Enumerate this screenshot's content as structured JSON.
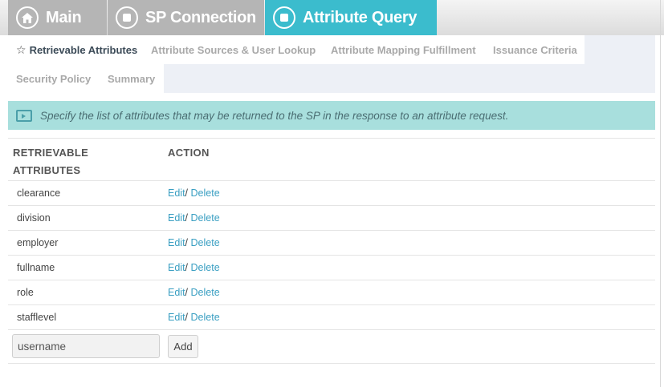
{
  "wizard": {
    "main_label": "Main",
    "sp_label": "SP Connection",
    "aq_label": "Attribute Query"
  },
  "tabs": [
    {
      "label": "Retrievable Attributes",
      "active": true
    },
    {
      "label": "Attribute Sources & User Lookup",
      "active": false
    },
    {
      "label": "Attribute Mapping Fulfillment",
      "active": false
    },
    {
      "label": "Issuance Criteria",
      "active": false
    },
    {
      "label": "Security Policy",
      "active": false
    },
    {
      "label": "Summary",
      "active": false
    }
  ],
  "banner": {
    "text": "Specify the list of attributes that may be returned to the SP in the response to an attribute request."
  },
  "table": {
    "headers": {
      "attributes_line1": "RETRIEVABLE",
      "attributes_line2": "ATTRIBUTES",
      "action": "ACTION"
    },
    "rows": [
      {
        "name": "clearance",
        "edit": "Edit",
        "sep": "/",
        "delete": "Delete"
      },
      {
        "name": "division",
        "edit": "Edit",
        "sep": "/",
        "delete": "Delete"
      },
      {
        "name": "employer",
        "edit": "Edit",
        "sep": "/",
        "delete": "Delete"
      },
      {
        "name": "fullname",
        "edit": "Edit",
        "sep": "/",
        "delete": "Delete"
      },
      {
        "name": "role",
        "edit": "Edit",
        "sep": "/",
        "delete": "Delete"
      },
      {
        "name": "stafflevel",
        "edit": "Edit",
        "sep": "/",
        "delete": "Delete"
      }
    ],
    "add": {
      "input_value": "username",
      "button_label": "Add"
    }
  },
  "colors": {
    "accent": "#3bbccd",
    "inactive_step": "#b5b5b5",
    "banner_bg": "#a8dfdd",
    "link": "#3a9fc2"
  },
  "icons": {
    "main": "home-icon",
    "sp": "stop-circle-icon",
    "aq": "stop-circle-icon",
    "active_tab": "star-icon",
    "banner": "slideshow-icon"
  }
}
